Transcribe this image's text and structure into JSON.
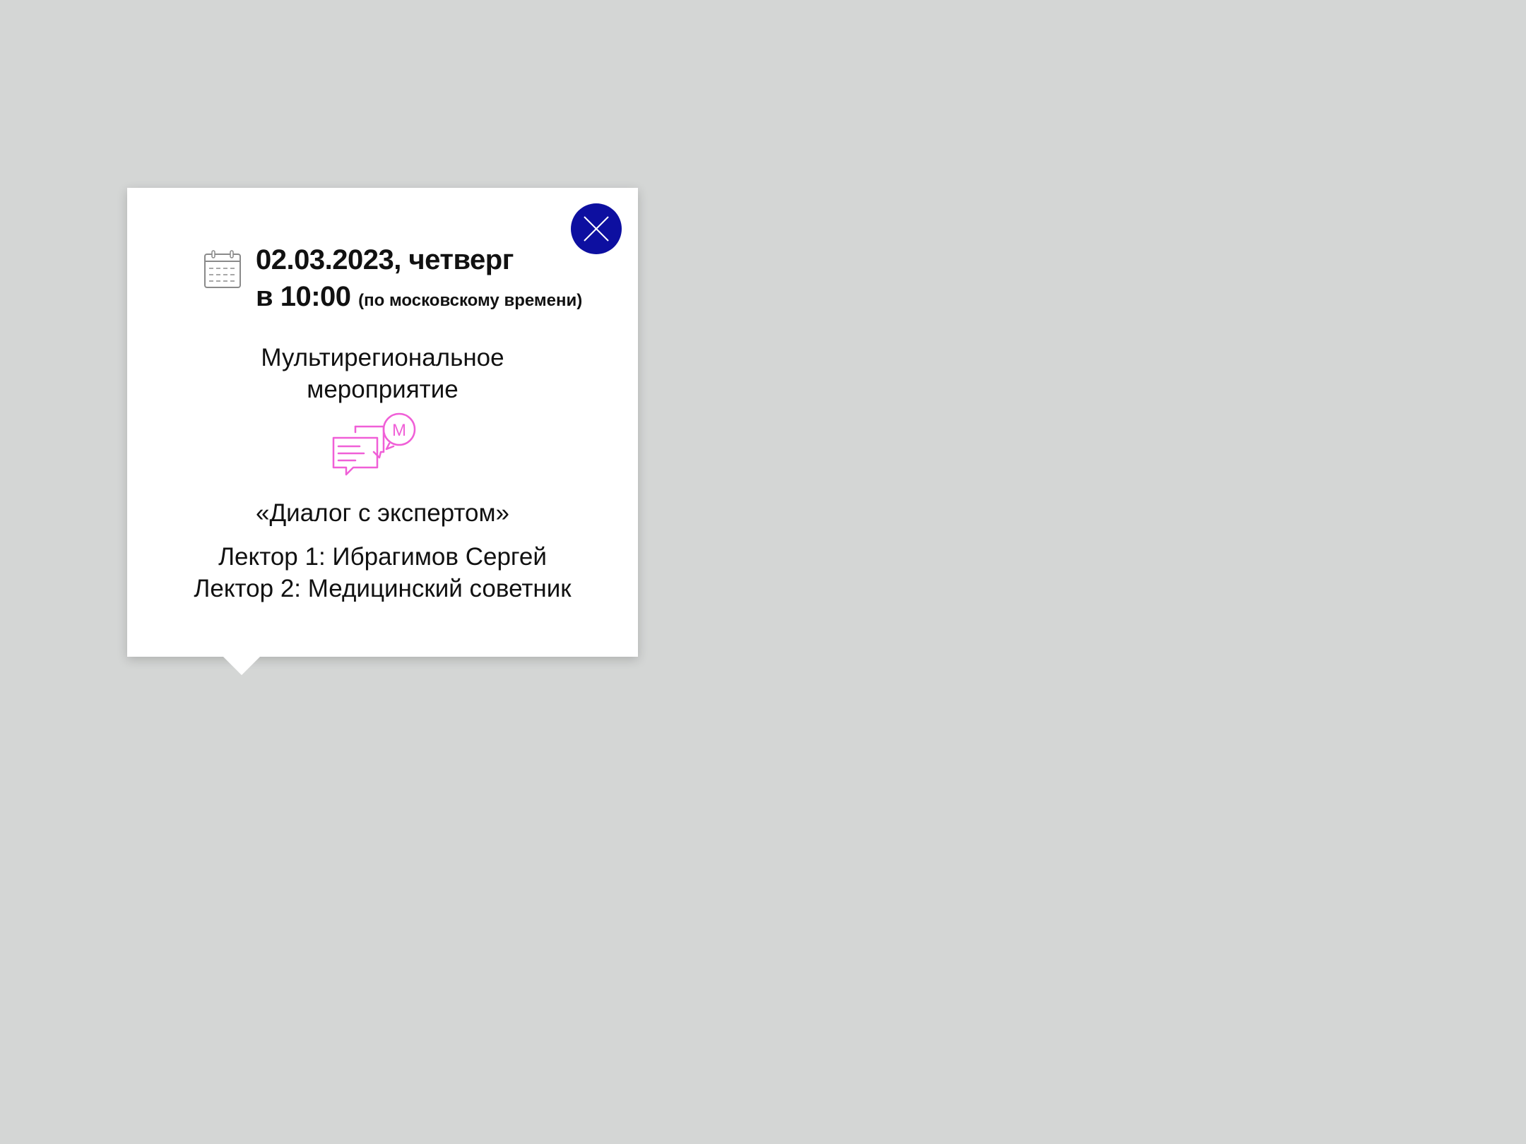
{
  "popup": {
    "close_icon": "close-icon",
    "calendar_icon": "calendar-icon",
    "dialog_icon": "dialog-expert-icon",
    "dialog_icon_letter": "М",
    "date": "02.03.2023, четверг",
    "time_prefix": "в 10:00",
    "time_note": "(по московскому времени)",
    "event_type_line1": "Мультирегиональное",
    "event_type_line2": "мероприятие",
    "event_title": "«Диалог с экспертом»",
    "lecturers": [
      "Лектор 1: Ибрагимов Сергей",
      "Лектор 2: Медицинский советник"
    ]
  },
  "colors": {
    "background": "#d4d6d5",
    "popup": "#ffffff",
    "close_button": "#0d0fa0",
    "accent_pink": "#f05fd7",
    "text": "#111111",
    "icon_gray": "#8a8a8a"
  }
}
